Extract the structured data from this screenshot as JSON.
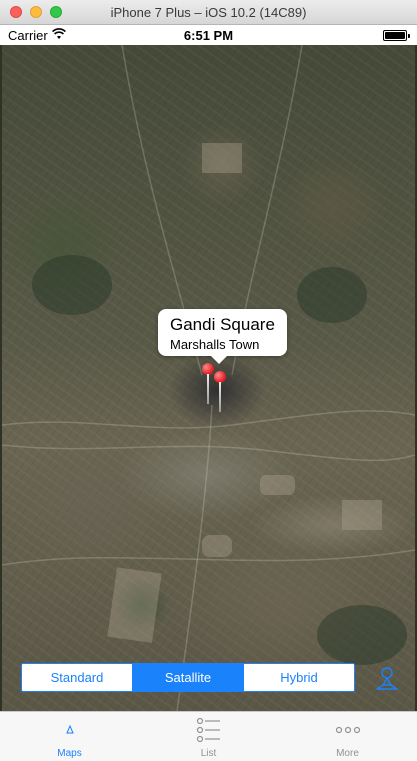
{
  "window": {
    "title": "iPhone 7 Plus – iOS 10.2 (14C89)"
  },
  "status_bar": {
    "carrier": "Carrier",
    "time": "6:51 PM"
  },
  "map": {
    "callout": {
      "title": "Gandi Square",
      "subtitle": "Marshalls Town"
    },
    "pin_color": "#e0262a"
  },
  "map_type": {
    "options": [
      "Standard",
      "Satallite",
      "Hybrid"
    ],
    "selected": "Satallite"
  },
  "tab_bar": {
    "items": [
      {
        "label": "Maps",
        "icon": "map-pin-icon",
        "active": true
      },
      {
        "label": "List",
        "icon": "list-icon",
        "active": false
      },
      {
        "label": "More",
        "icon": "more-icon",
        "active": false
      }
    ]
  },
  "colors": {
    "accent": "#1a82fb",
    "inactive": "#929292"
  }
}
